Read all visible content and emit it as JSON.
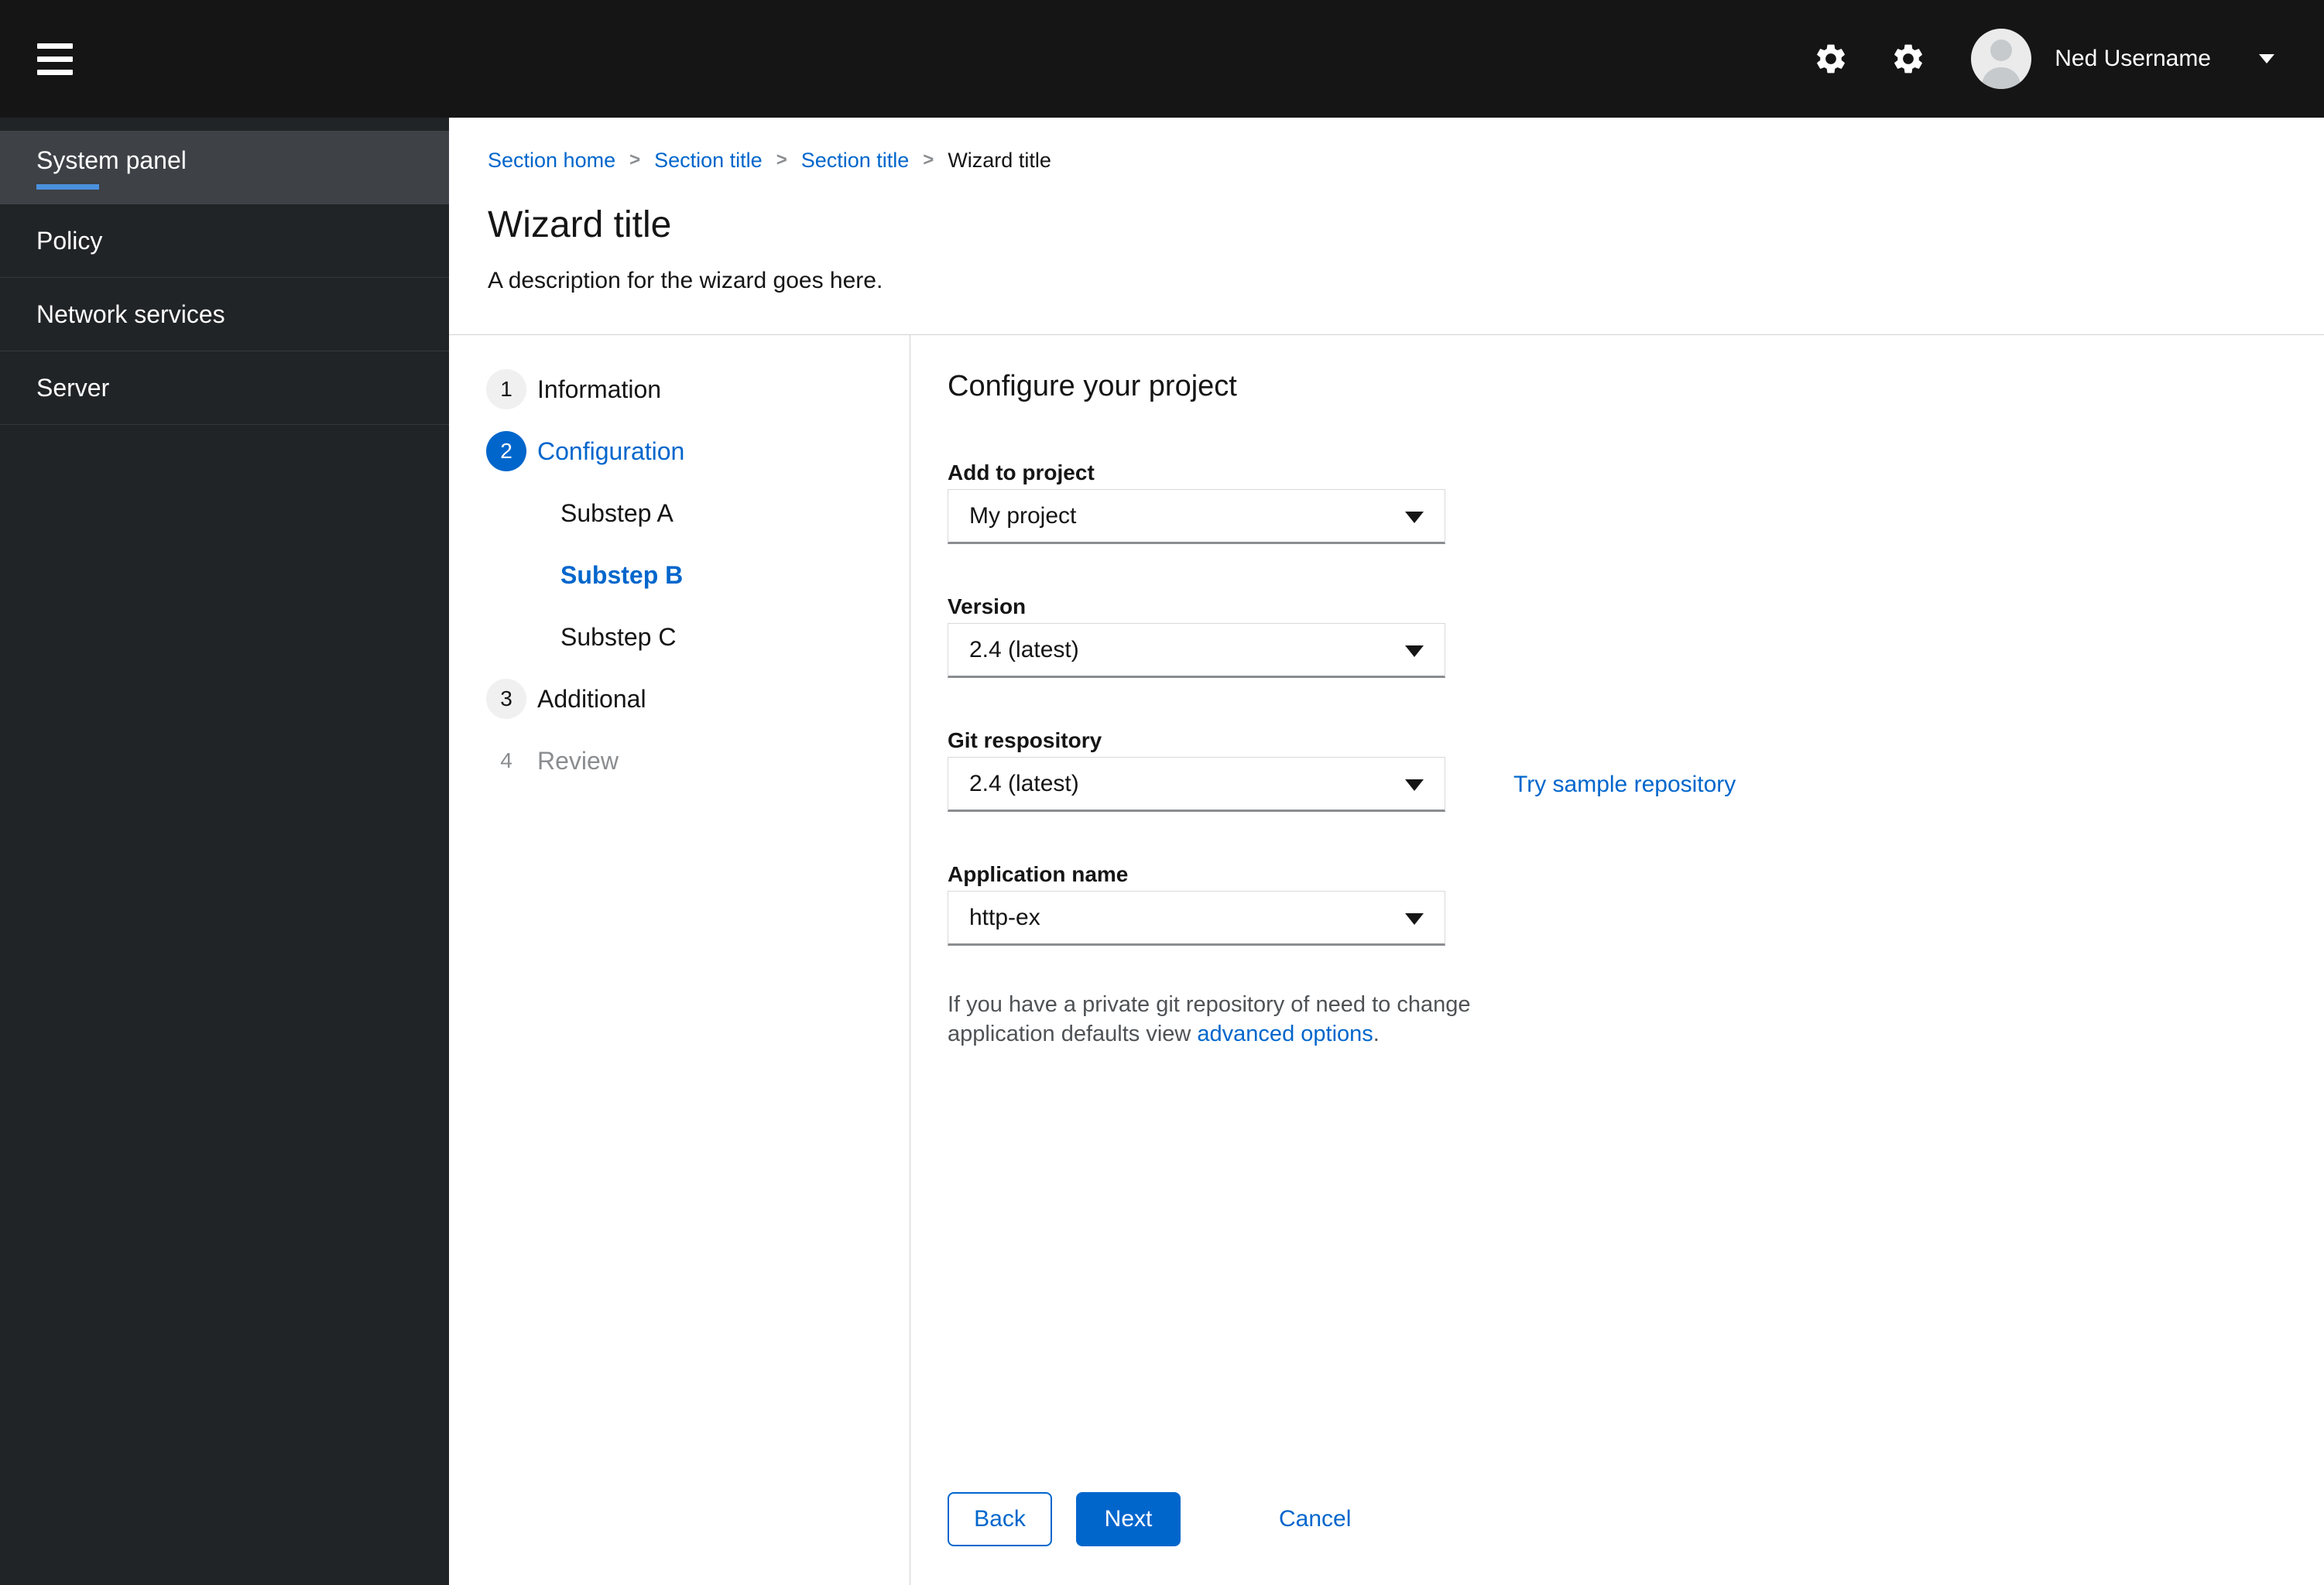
{
  "colors": {
    "masthead_bg": "#151515",
    "sidebar_bg": "#212427",
    "sidebar_active_bg": "#3e4146",
    "sidebar_active_indicator": "#4a90dd",
    "primary_blue": "#0066cc",
    "divider": "#d2d2d2",
    "step_circle_bg": "#f0f0f0",
    "disabled_gray": "#8a8d90",
    "helper_gray": "#4f5255"
  },
  "masthead": {
    "username": "Ned Username",
    "icons": [
      "hamburger-icon",
      "gear-icon",
      "gear-icon",
      "avatar",
      "chevron-down-icon"
    ]
  },
  "sidebar": {
    "items": [
      {
        "label": "System panel",
        "active": true
      },
      {
        "label": "Policy",
        "active": false
      },
      {
        "label": "Network services",
        "active": false
      },
      {
        "label": "Server",
        "active": false
      }
    ]
  },
  "breadcrumb": {
    "items": [
      {
        "label": "Section home",
        "link": true
      },
      {
        "label": "Section title",
        "link": true
      },
      {
        "label": "Section title",
        "link": true
      },
      {
        "label": "Wizard title",
        "link": false
      }
    ]
  },
  "page_header": {
    "title": "Wizard title",
    "description": "A description for the wizard goes here."
  },
  "wizard": {
    "nav": [
      {
        "number": "1",
        "label": "Information",
        "state": "default"
      },
      {
        "number": "2",
        "label": "Configuration",
        "state": "current"
      },
      {
        "label": "Substep A",
        "substep": true,
        "state": "default"
      },
      {
        "label": "Substep B",
        "substep": true,
        "state": "current"
      },
      {
        "label": "Substep C",
        "substep": true,
        "state": "default"
      },
      {
        "number": "3",
        "label": "Additional",
        "state": "default"
      },
      {
        "number": "4",
        "label": "Review",
        "state": "disabled"
      }
    ],
    "content": {
      "heading": "Configure your project",
      "fields": [
        {
          "label": "Add to project",
          "value": "My project",
          "type": "select"
        },
        {
          "label": "Version",
          "value": "2.4 (latest)",
          "type": "select"
        },
        {
          "label": "Git respository",
          "value": "2.4 (latest)",
          "type": "select",
          "side_link": "Try sample repository"
        },
        {
          "label": "Application name",
          "value": "http-ex",
          "type": "select"
        }
      ],
      "helper_text": "If you have a private git repository of need to change application defaults view ",
      "helper_link": "advanced options",
      "helper_suffix": "."
    },
    "footer": {
      "back": "Back",
      "next": "Next",
      "cancel": "Cancel"
    }
  }
}
